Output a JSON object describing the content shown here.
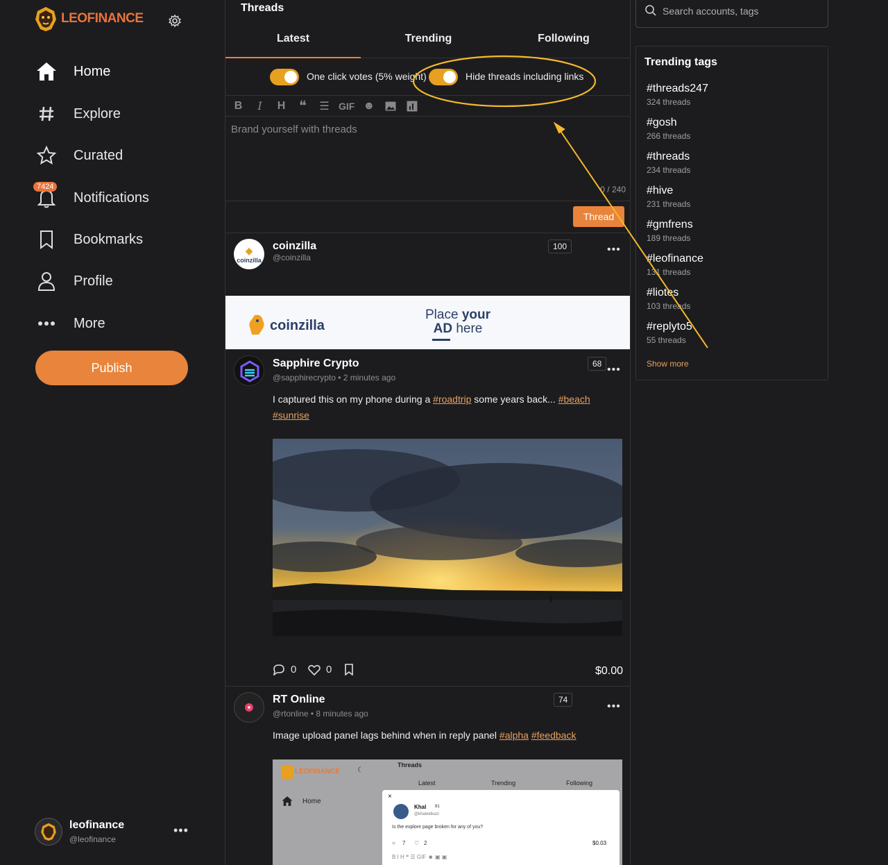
{
  "sidebar": {
    "brand": "LEOFINANCE",
    "nav": [
      {
        "label": "Home"
      },
      {
        "label": "Explore"
      },
      {
        "label": "Curated"
      },
      {
        "label": "Notifications",
        "badge": "7424"
      },
      {
        "label": "Bookmarks"
      },
      {
        "label": "Profile"
      },
      {
        "label": "More"
      }
    ],
    "publish_label": "Publish",
    "account": {
      "name": "leofinance",
      "handle": "@leofinance"
    }
  },
  "main": {
    "title": "Threads",
    "tabs": [
      {
        "label": "Latest"
      },
      {
        "label": "Trending"
      },
      {
        "label": "Following"
      }
    ],
    "toggles": [
      {
        "label": "One click votes (5% weight)",
        "on": true
      },
      {
        "label": "Hide threads including links",
        "on": true
      }
    ],
    "toolbar": {
      "gif": "GIF"
    },
    "composer": {
      "placeholder": "Brand yourself with threads",
      "counter": "0 / 240",
      "submit": "Thread"
    },
    "posts": [
      {
        "name": "coinzilla",
        "rep": "100",
        "handle": "@coinzilla",
        "avatar_text": "coinzilla"
      },
      {
        "name": "Sapphire Crypto",
        "rep": "68",
        "handle": "@sapphirecrypto",
        "time": "2 minutes ago",
        "text": "I captured this on my phone during a ",
        "tags": [
          "#roadtrip",
          "#beach",
          "#sunrise"
        ],
        "text_mid": " some years back... ",
        "comments": "0",
        "likes": "0",
        "payout": "$0.00"
      },
      {
        "name": "RT Online",
        "rep": "74",
        "handle": "@rtonline",
        "time": "8 minutes ago",
        "text": "Image upload panel lags behind when in reply panel ",
        "tags": [
          "#alpha",
          "#feedback"
        ]
      }
    ],
    "ad": {
      "brand": "coinzilla",
      "line1_a": "Place ",
      "line1_b": "your",
      "line2_a": "AD",
      "line2_b": " here"
    },
    "embedded_screenshot": {
      "brand": "LEOFINANCE",
      "title": "Threads",
      "tabs": [
        "Latest",
        "Trending",
        "Following"
      ],
      "nav_home": "Home",
      "close": "×",
      "user": "Khal",
      "user_rep": "81",
      "user_handle": "@khaleelkazi",
      "text": "Is the explore page broken for any of you?",
      "comments": "7",
      "likes": "2",
      "payout": "$0.03"
    }
  },
  "right": {
    "search_placeholder": "Search accounts, tags",
    "trending_title": "Trending tags",
    "tags": [
      {
        "tag": "#threads247",
        "count": "324 threads"
      },
      {
        "tag": "#gosh",
        "count": "266 threads"
      },
      {
        "tag": "#threads",
        "count": "234 threads"
      },
      {
        "tag": "#hive",
        "count": "231 threads"
      },
      {
        "tag": "#gmfrens",
        "count": "189 threads"
      },
      {
        "tag": "#leofinance",
        "count": "131 threads"
      },
      {
        "tag": "#liotes",
        "count": "103 threads"
      },
      {
        "tag": "#replyto5",
        "count": "55 threads"
      }
    ],
    "show_more": "Show more"
  },
  "colors": {
    "accent": "#e8843b",
    "toggle": "#e8a020",
    "annotation": "#f5b92a",
    "background": "#1c1c1e"
  }
}
